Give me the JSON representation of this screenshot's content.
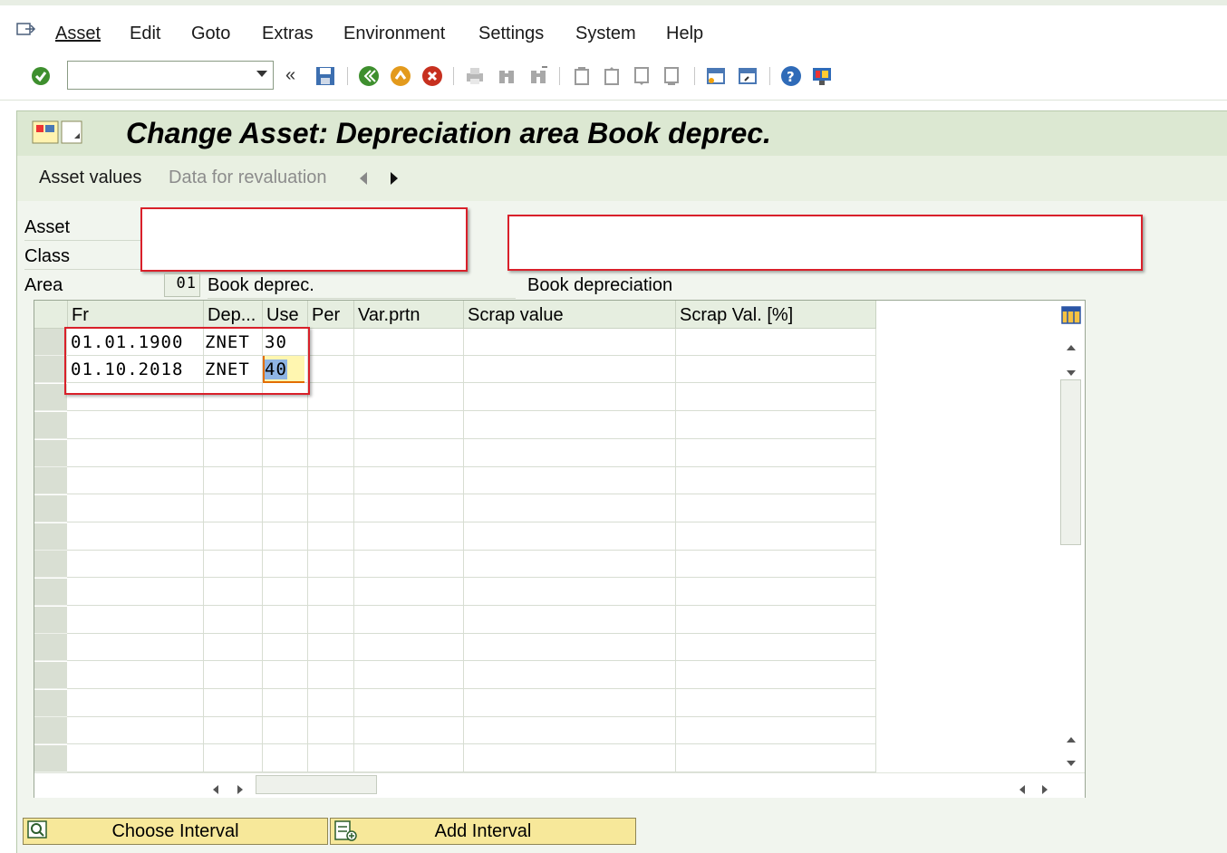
{
  "menu": {
    "items": [
      {
        "label": "Asset"
      },
      {
        "label": "Edit"
      },
      {
        "label": "Goto"
      },
      {
        "label": "Extras"
      },
      {
        "label": "Environment"
      },
      {
        "label": "Settings"
      },
      {
        "label": "System"
      },
      {
        "label": "Help"
      }
    ]
  },
  "toolbar": {
    "command_value": "",
    "icons": [
      "enter-icon",
      "back-chevron-icon",
      "save-icon",
      "back-icon",
      "exit-icon",
      "cancel-icon",
      "print-icon",
      "find-icon",
      "find-next-icon",
      "first-page-icon",
      "previous-page-icon",
      "next-page-icon",
      "last-page-icon",
      "create-session-icon",
      "shortcut-icon",
      "help-icon",
      "customize-layout-icon"
    ]
  },
  "header": {
    "title": "Change Asset: Depreciation area Book deprec."
  },
  "tabs": {
    "asset_values": "Asset values",
    "data_for_revaluation": "Data for revaluation"
  },
  "form": {
    "asset_label": "Asset",
    "class_label": "Class",
    "area_label": "Area",
    "area_code": "01",
    "area_short": "Book deprec.",
    "area_long": "Book depreciation"
  },
  "table": {
    "columns": [
      "Fr",
      "Dep...",
      "Use",
      "Per",
      "Var.prtn",
      "Scrap value",
      "Scrap Val. [%]"
    ],
    "rows": [
      {
        "fr": "01.01.1900",
        "dep": "ZNET",
        "use": "30",
        "per": "",
        "var": "",
        "scrap": "",
        "scrap_pct": ""
      },
      {
        "fr": "01.10.2018",
        "dep": "ZNET",
        "use": "40",
        "per": "",
        "var": "",
        "scrap": "",
        "scrap_pct": ""
      }
    ]
  },
  "buttons": {
    "choose_interval": "Choose Interval",
    "add_interval": "Add Interval"
  },
  "colors": {
    "title_bg": "#dce8d2",
    "button_bg": "#f7e89a",
    "highlight_red": "#d9202a"
  }
}
